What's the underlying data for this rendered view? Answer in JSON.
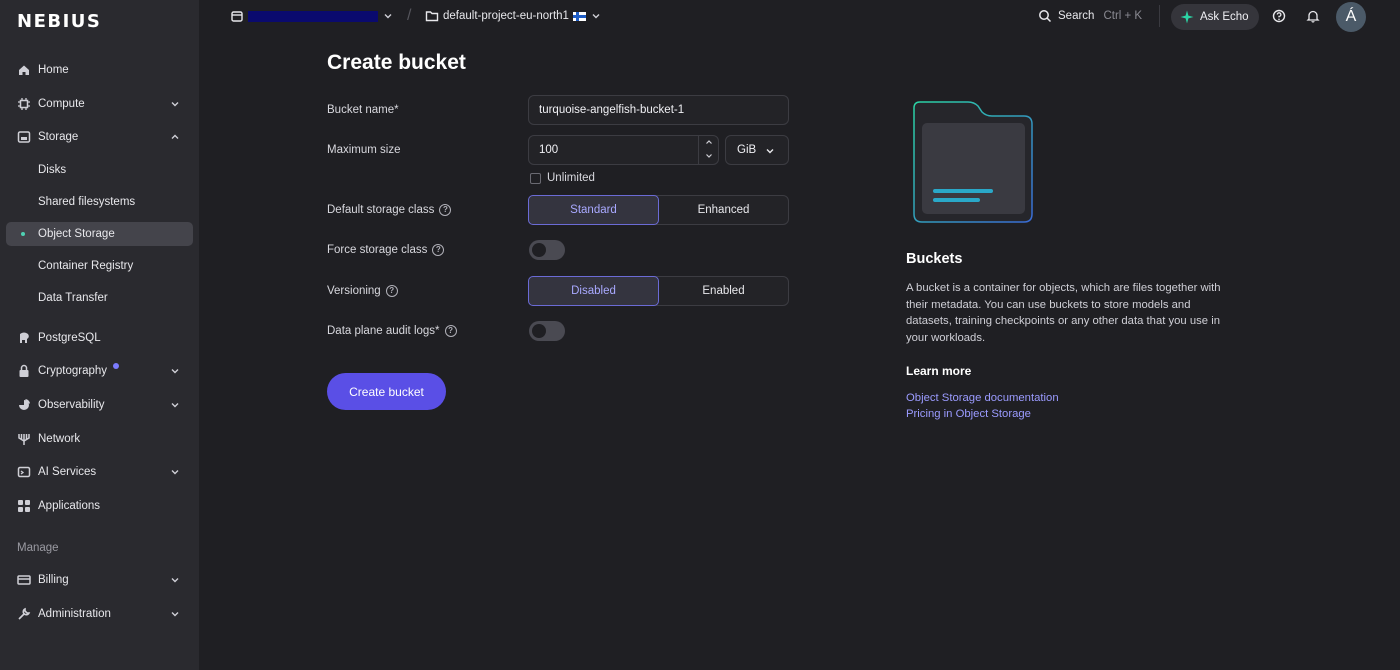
{
  "app": {
    "logo": "NEBIUS"
  },
  "sidebar": {
    "items": [
      {
        "label": "Home",
        "icon": "home-icon"
      },
      {
        "label": "Compute",
        "icon": "cpu-icon"
      },
      {
        "label": "Storage",
        "icon": "storage-icon"
      },
      {
        "label": "Disks"
      },
      {
        "label": "Shared filesystems"
      },
      {
        "label": "Object Storage"
      },
      {
        "label": "Container Registry"
      },
      {
        "label": "Data Transfer"
      },
      {
        "label": "PostgreSQL",
        "icon": "elephant-icon"
      },
      {
        "label": "Cryptography",
        "icon": "lock-icon"
      },
      {
        "label": "Observability",
        "icon": "chart-icon"
      },
      {
        "label": "Network",
        "icon": "network-icon"
      },
      {
        "label": "AI Services",
        "icon": "ai-icon"
      },
      {
        "label": "Applications",
        "icon": "grid-icon"
      },
      {
        "label": "Billing",
        "icon": "billing-icon"
      },
      {
        "label": "Administration",
        "icon": "wrench-icon"
      }
    ],
    "section_manage": "Manage"
  },
  "topbar": {
    "project": "default-project-eu-north1",
    "search_label": "Search",
    "search_shortcut": "Ctrl + K",
    "ask_echo": "Ask Echo",
    "avatar_initial": "Á"
  },
  "form": {
    "title": "Create bucket",
    "bucket_name_label": "Bucket name*",
    "bucket_name_value": "turquoise-angelfish-bucket-1",
    "max_size_label": "Maximum size",
    "max_size_value": "100",
    "unit": "GiB",
    "unlimited_label": "Unlimited",
    "storage_class_label": "Default storage class",
    "storage_class_options": [
      "Standard",
      "Enhanced"
    ],
    "force_class_label": "Force storage class",
    "versioning_label": "Versioning",
    "versioning_options": [
      "Disabled",
      "Enabled"
    ],
    "audit_logs_label": "Data plane audit logs*",
    "submit_label": "Create bucket"
  },
  "info": {
    "title": "Buckets",
    "description": "A bucket is a container for objects, which are files together with their metadata. You can use buckets to store models and datasets, training checkpoints or any other data that you use in your workloads.",
    "learn_more": "Learn more",
    "links": [
      "Object Storage documentation",
      "Pricing in Object Storage"
    ]
  },
  "colors": {
    "accent": "#5a4fe6",
    "link": "#9b9bff",
    "selected_dot": "#4fd1b3",
    "illustration": "#2bd4a4"
  }
}
